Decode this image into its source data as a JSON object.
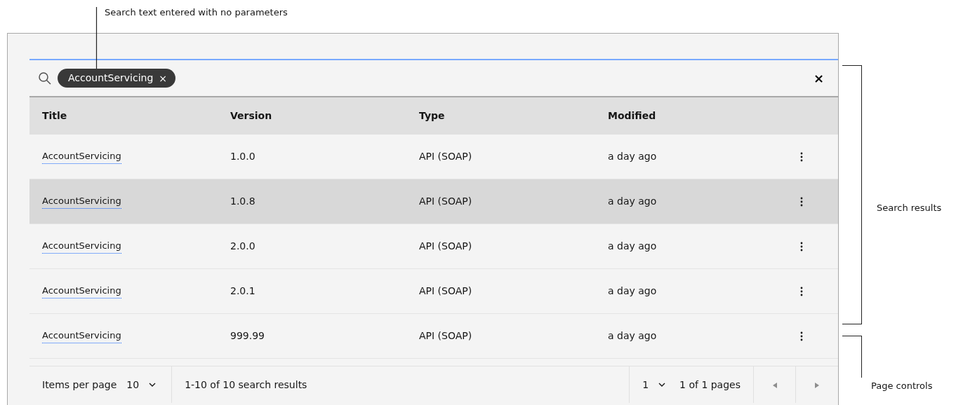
{
  "annotations": {
    "search_note": "Search text entered with no parameters",
    "results_note": "Search results",
    "pagination_note": "Page controls"
  },
  "search": {
    "tags": [
      {
        "label": "AccountServicing",
        "remove": "×"
      }
    ],
    "clear": "×"
  },
  "table": {
    "columns": [
      "Title",
      "Version",
      "Type",
      "Modified"
    ],
    "rows": [
      {
        "title": "AccountServicing",
        "version": "1.0.0",
        "type": "API (SOAP)",
        "modified": "a day ago",
        "hovered": false
      },
      {
        "title": "AccountServicing",
        "version": "1.0.8",
        "type": "API (SOAP)",
        "modified": "a day ago",
        "hovered": true
      },
      {
        "title": "AccountServicing",
        "version": "2.0.0",
        "type": "API (SOAP)",
        "modified": "a day ago",
        "hovered": false
      },
      {
        "title": "AccountServicing",
        "version": "2.0.1",
        "type": "API (SOAP)",
        "modified": "a day ago",
        "hovered": false
      },
      {
        "title": "AccountServicing",
        "version": "999.99",
        "type": "API (SOAP)",
        "modified": "a day ago",
        "hovered": false
      }
    ]
  },
  "pagination": {
    "items_per_page_label": "Items per page",
    "items_per_page": "10",
    "range": "1-10 of 10 search results",
    "page": "1",
    "pages": "1 of 1 pages"
  }
}
